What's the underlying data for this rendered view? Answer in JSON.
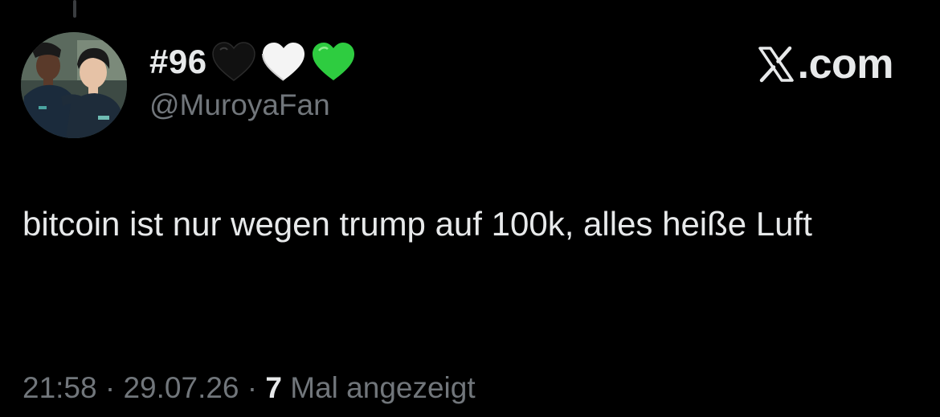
{
  "colors": {
    "background": "#000000",
    "primary_text": "#e7e9ea",
    "secondary_text": "#71767b",
    "heart_black": "#111111",
    "heart_white": "#ffffff",
    "heart_green": "#2ecc40"
  },
  "author": {
    "display_name": "#96",
    "emojis": [
      "black-heart-icon",
      "white-heart-icon",
      "green-heart-icon"
    ],
    "handle": "@MuroyaFan"
  },
  "brand": {
    "icon": "x-logo-icon",
    "label": ".com"
  },
  "tweet": {
    "text": "bitcoin ist nur wegen trump auf 100k, alles heiße Luft"
  },
  "meta": {
    "time": "21:58",
    "separator": " · ",
    "date": "29.07.26",
    "views_count": "7",
    "views_label": " Mal angezeigt"
  }
}
